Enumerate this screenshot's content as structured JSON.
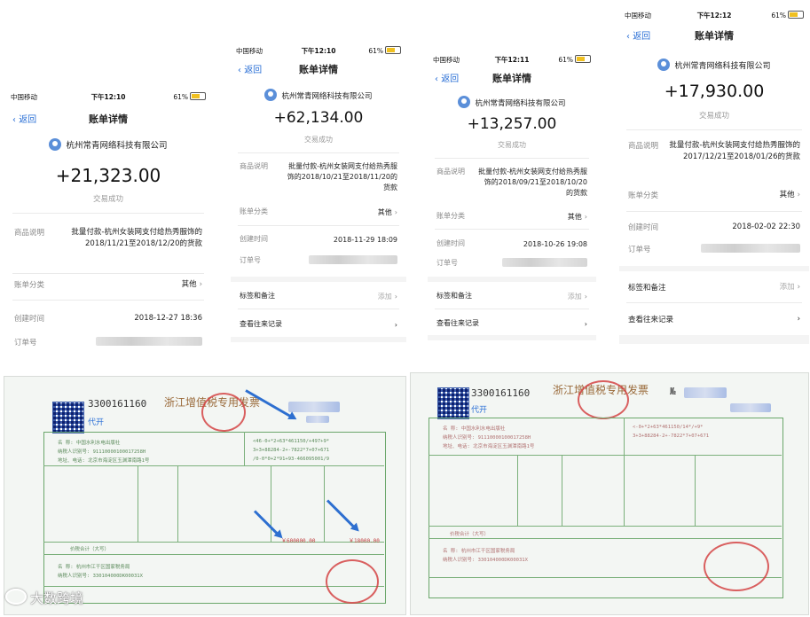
{
  "screens": [
    {
      "status_bar": {
        "carrier": "中国移动",
        "time": "下午12:10",
        "battery": "61%"
      },
      "nav": {
        "back": "返回",
        "title": "账单详情"
      },
      "merchant": "杭州常青网络科技有限公司",
      "amount": "+21,323.00",
      "status": "交易成功",
      "desc_label": "商品说明",
      "desc_value": "批量付款-杭州女装网支付给热秀服饰的2018/11/21至2018/12/20的货款",
      "category_label": "账单分类",
      "category_value": "其他",
      "created_label": "创建时间",
      "created_value": "2018-12-27 18:36",
      "order_label": "订单号"
    },
    {
      "status_bar": {
        "carrier": "中国移动",
        "time": "下午12:10",
        "battery": "61%"
      },
      "nav": {
        "back": "返回",
        "title": "账单详情"
      },
      "merchant": "杭州常青网络科技有限公司",
      "amount": "+62,134.00",
      "status": "交易成功",
      "desc_label": "商品说明",
      "desc_value": "批量付款-杭州女装网支付给热秀服饰的2018/10/21至2018/11/20的货款",
      "category_label": "账单分类",
      "category_value": "其他",
      "created_label": "创建时间",
      "created_value": "2018-11-29 18:09",
      "order_label": "订单号",
      "tags_label": "标签和备注",
      "tags_value": "添加",
      "history_label": "查看往来记录"
    },
    {
      "status_bar": {
        "carrier": "中国移动",
        "time": "下午12:11",
        "battery": "61%"
      },
      "nav": {
        "back": "返回",
        "title": "账单详情"
      },
      "merchant": "杭州常青网络科技有限公司",
      "amount": "+13,257.00",
      "status": "交易成功",
      "desc_label": "商品说明",
      "desc_value": "批量付款-杭州女装网支付给热秀服饰的2018/09/21至2018/10/20的货款",
      "category_label": "账单分类",
      "category_value": "其他",
      "created_label": "创建时间",
      "created_value": "2018-10-26 19:08",
      "order_label": "订单号",
      "tags_label": "标签和备注",
      "tags_value": "添加",
      "history_label": "查看往来记录"
    },
    {
      "status_bar": {
        "carrier": "中国移动",
        "time": "下午12:12",
        "battery": "61%"
      },
      "nav": {
        "back": "返回",
        "title": "账单详情"
      },
      "merchant": "杭州常青网络科技有限公司",
      "amount": "+17,930.00",
      "status": "交易成功",
      "desc_label": "商品说明",
      "desc_value": "批量付款-杭州女装网支付给热秀服饰的2017/12/21至2018/01/26的货款",
      "category_label": "账单分类",
      "category_value": "其他",
      "created_label": "创建时间",
      "created_value": "2018-02-02 22:30",
      "order_label": "订单号",
      "tags_label": "标签和备注",
      "tags_value": "添加",
      "history_label": "查看往来记录"
    }
  ],
  "invoices": [
    {
      "code": "3300161160",
      "tag": "代开",
      "title": "浙江增值税专用发票",
      "amount_text": "￥600000.00",
      "tax_text": "￥18000.00",
      "total_label": "价税合计（大写）"
    },
    {
      "code": "3300161160",
      "tag": "代开",
      "title": "浙江增值税专用发票",
      "no_label": "№",
      "total_label": "价税合计（大写）"
    }
  ],
  "watermark": "大数跨境",
  "colors": {
    "link": "#2a6fd6",
    "stamp": "#d23a3a",
    "invoice_line": "#7bb07b",
    "arrow": "#2d6fd0"
  }
}
